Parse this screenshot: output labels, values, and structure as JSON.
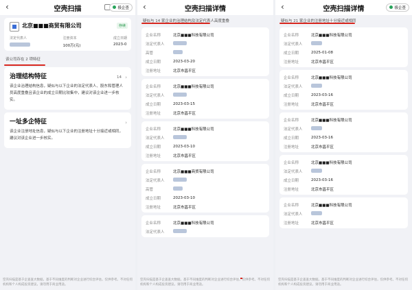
{
  "p1": {
    "title": "空壳扫描",
    "mini_label": "极企查",
    "company_name": "北京■■■商贸有限公司",
    "tag": "存续",
    "meta_labels": [
      "法定代表人",
      "注册资本",
      "成立日期"
    ],
    "meta_values": [
      "",
      "100万(元)",
      "2023-0"
    ],
    "hint": "该公司存在 2 项特征",
    "sections": [
      {
        "title": "治理结构特征",
        "count": "14",
        "text": "该企业治理结构信息，疑似与以下企业的法定代表人、股东和管理人员高度重叠且该企业的成立日期比较集中，建议对该企业进一步核实。"
      },
      {
        "title": "一址多企特征",
        "count": "",
        "text": "该企业注册地址信息，疑似与以下企业的注册地址十分接近或相同，建议对该企业进一步核实。"
      }
    ],
    "footnote": "空壳扫描是基于企查查大数据，基于不同维度的判断对企业进行综合评估，仅供参考。不对任何机构和个人构成投资建议，请勿用于商业用途。"
  },
  "p2": {
    "title": "空壳扫描详情",
    "hint": "疑似与 14 家企业的治理结构及法定代表人高度重叠",
    "labels": {
      "company": "企业名称",
      "rep": "法定代表人",
      "exec": "高管",
      "date": "成立日期",
      "addr": "注册地址"
    },
    "cards": [
      {
        "company": "北京■■■科技有限公司",
        "date": "2023-03-20",
        "addr": "北京市昌平区"
      },
      {
        "company": "北京■■■科技有限公司",
        "date": "2023-03-15",
        "addr": "北京市昌平区"
      },
      {
        "company": "北京■■■科技有限公司",
        "date": "2023-03-10",
        "addr": "北京市昌平区"
      },
      {
        "company": "北京■■■商贸有限公司",
        "date": "2023-03-10",
        "addr": "北京市昌平区"
      },
      {
        "company": "北京■■■科技有限公司",
        "date": "",
        "addr": ""
      }
    ],
    "footnote": "空壳扫描是基于企查查大数据，基于不同维度的判断对企业进行综合评估，仅供参考。不对任何机构和个人构成投资建议，请勿用于商业用途。"
  },
  "p3": {
    "title": "空壳扫描详情",
    "mini_label": "极企查",
    "hint": "疑似与 21 家企业的注册地址十分接近或相同",
    "labels": {
      "company": "企业名称",
      "rep": "法定代表人",
      "date": "成立日期",
      "addr": "注册地址"
    },
    "cards": [
      {
        "company": "北京■■■科技有限公司",
        "date": "2025-01-08",
        "addr": "北京市昌平区"
      },
      {
        "company": "北京■■■科技有限公司",
        "date": "2023-03-16",
        "addr": "北京市昌平区"
      },
      {
        "company": "北京■■■科技有限公司",
        "date": "2023-03-16",
        "addr": "北京市昌平区"
      },
      {
        "company": "北京■■■科技有限公司",
        "date": "2023-03-16",
        "addr": "北京市昌平区"
      },
      {
        "company": "北京■■■科技有限公司",
        "date": "",
        "addr": "北京市昌平区"
      }
    ],
    "footnote": "空壳扫描是基于企查查大数据，基于不同维度的判断对企业进行综合评估，仅供参考。不对任何机构和个人构成投资建议，请勿用于商业用途。"
  },
  "colors": {
    "accent_red": "#d7261e",
    "brand_green": "#27a35a",
    "link_blue": "#3b6ed6"
  }
}
